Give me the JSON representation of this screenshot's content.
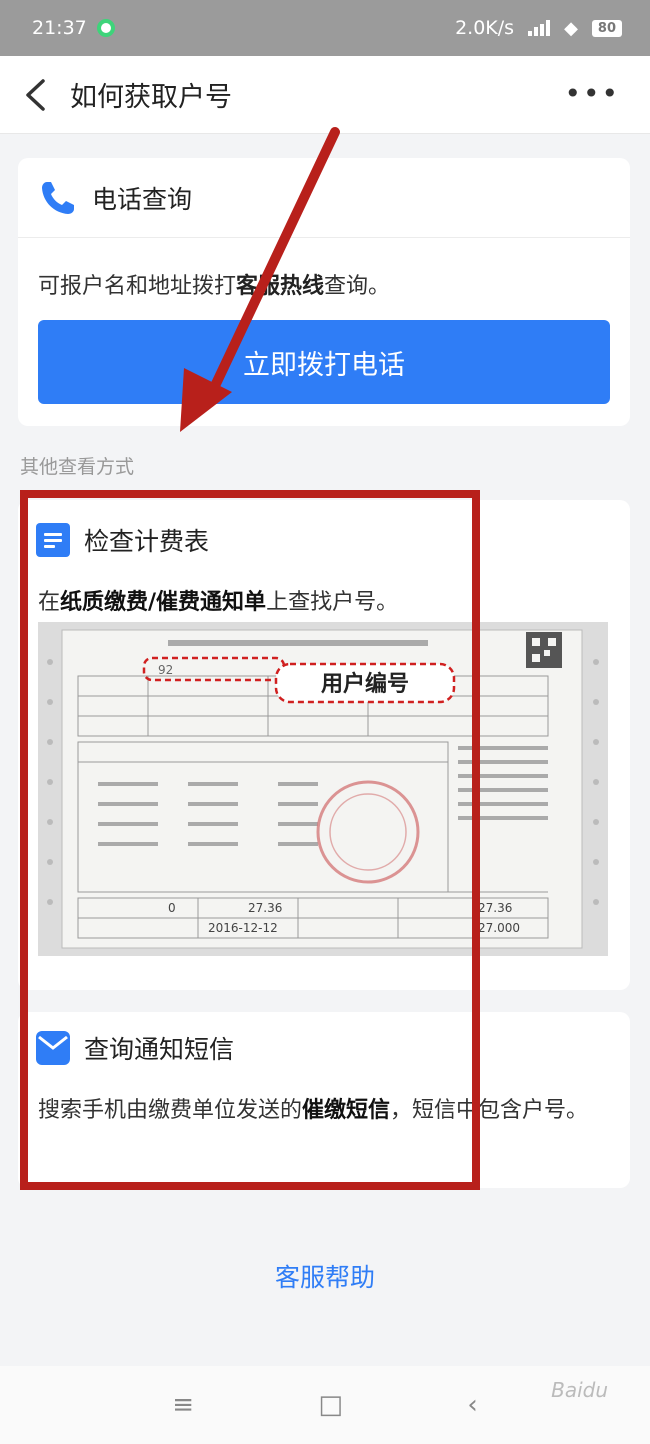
{
  "status_bar": {
    "time": "21:37",
    "speed": "2.0K/s",
    "battery": "80"
  },
  "header": {
    "title": "如何获取户号"
  },
  "phone_card": {
    "title": "电话查询",
    "desc_prefix": "可报户名和地址拨打",
    "desc_bold": "客服热线",
    "desc_suffix": "查询。",
    "call_button": "立即拨打电话"
  },
  "section_label": "其他查看方式",
  "bill_card": {
    "title": "检查计费表",
    "desc_prefix": "在",
    "desc_bold": "纸质缴费/催费通知单",
    "desc_suffix": "上查找户号。",
    "image": {
      "callout": "用户编号",
      "date": "2016-12-12",
      "amount_1": "27.36",
      "amount_2": "27.36",
      "amount_3": "27.000",
      "amount_4": "0",
      "account_prefix": "92"
    }
  },
  "sms_card": {
    "title": "查询通知短信",
    "desc_prefix": "搜索手机由缴费单位发送的",
    "desc_bold": "催缴短信",
    "desc_suffix": "，短信中包含户号。"
  },
  "help_link": "客服帮助",
  "nav": {
    "menu": "≡",
    "home": "□",
    "back": "‹"
  },
  "watermark": "Baidu",
  "colors": {
    "accent": "#2f7df6",
    "annotation_red": "#b8201b"
  }
}
